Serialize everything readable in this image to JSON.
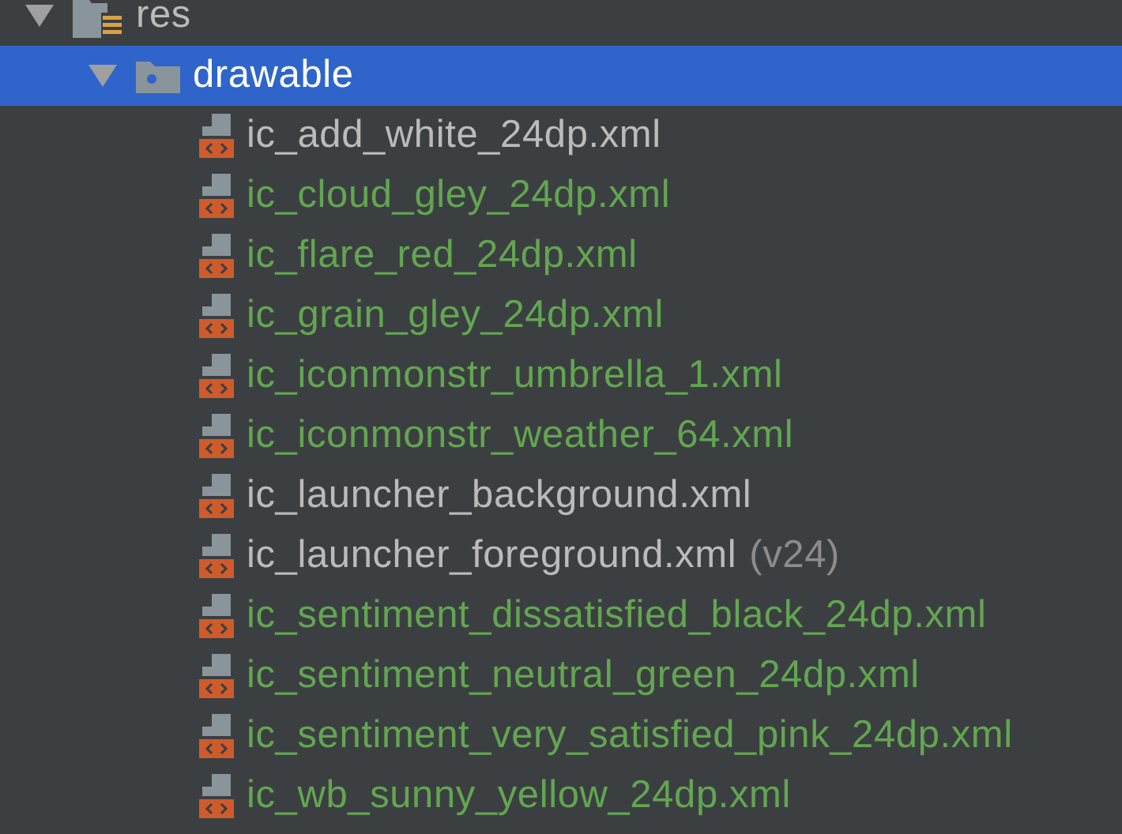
{
  "tree": [
    {
      "label": "res",
      "kind": "res-folder",
      "expanded": true,
      "selected": false,
      "children": [
        {
          "label": "drawable",
          "kind": "folder",
          "expanded": true,
          "selected": true,
          "children": [
            {
              "label": "ic_add_white_24dp.xml",
              "kind": "xml",
              "added": false,
              "selected": false
            },
            {
              "label": "ic_cloud_gley_24dp.xml",
              "kind": "xml",
              "added": true,
              "selected": false
            },
            {
              "label": "ic_flare_red_24dp.xml",
              "kind": "xml",
              "added": true,
              "selected": false
            },
            {
              "label": "ic_grain_gley_24dp.xml",
              "kind": "xml",
              "added": true,
              "selected": false
            },
            {
              "label": "ic_iconmonstr_umbrella_1.xml",
              "kind": "xml",
              "added": true,
              "selected": false
            },
            {
              "label": "ic_iconmonstr_weather_64.xml",
              "kind": "xml",
              "added": true,
              "selected": false
            },
            {
              "label": "ic_launcher_background.xml",
              "kind": "xml",
              "added": false,
              "selected": false
            },
            {
              "label": "ic_launcher_foreground.xml",
              "kind": "xml",
              "added": false,
              "selected": false,
              "suffix": "(v24)"
            },
            {
              "label": "ic_sentiment_dissatisfied_black_24dp.xml",
              "kind": "xml",
              "added": true,
              "selected": false
            },
            {
              "label": "ic_sentiment_neutral_green_24dp.xml",
              "kind": "xml",
              "added": true,
              "selected": false
            },
            {
              "label": "ic_sentiment_very_satisfied_pink_24dp.xml",
              "kind": "xml",
              "added": true,
              "selected": false
            },
            {
              "label": "ic_wb_sunny_yellow_24dp.xml",
              "kind": "xml",
              "added": true,
              "selected": false
            }
          ]
        }
      ]
    }
  ]
}
